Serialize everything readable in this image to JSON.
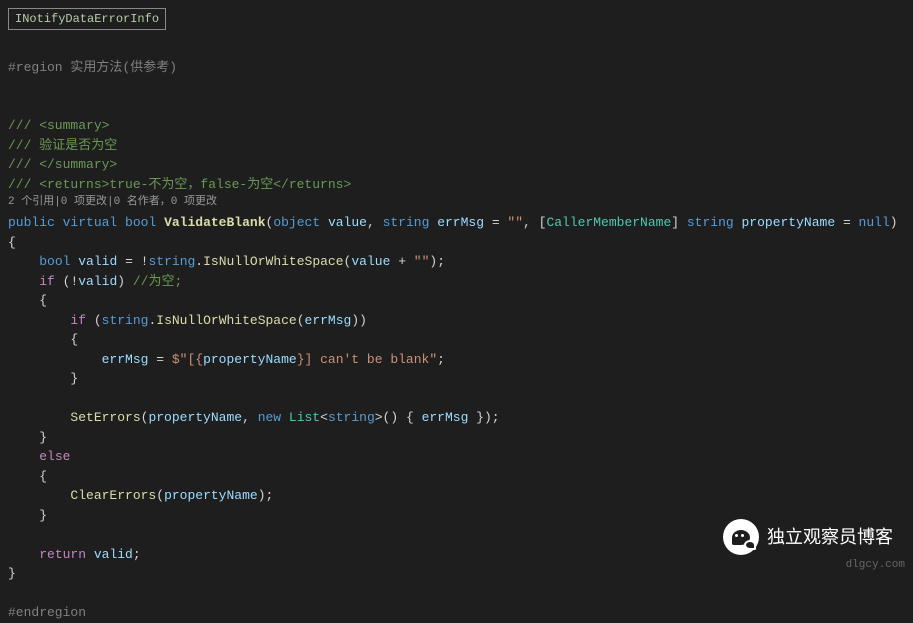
{
  "interface_name": "INotifyDataErrorInfo",
  "region_line": "#region 实用方法(供参考)",
  "doc_comments": {
    "summary_open": "/// <summary>",
    "summary_body": "/// 验证是否为空",
    "summary_close": "/// </summary>",
    "returns": "/// <returns>true-不为空，false-为空</returns>"
  },
  "codelens": "2 个引用|0 项更改|0 名作者，0 项更改",
  "method_signature": {
    "public": "public",
    "virtual": "virtual",
    "bool": "bool",
    "name": "ValidateBlank",
    "param1_type": "object",
    "param1_name": "value",
    "param2_type": "string",
    "param2_name": "errMsg",
    "param2_default": "\"\"",
    "attr": "CallerMemberName",
    "param3_type": "string",
    "param3_name": "propertyName",
    "param3_default": "null"
  },
  "body": {
    "brace_open": "{",
    "line_valid": {
      "bool": "bool",
      "var": "valid",
      "string": "string",
      "method": "IsNullOrWhiteSpace",
      "param": "value",
      "str": "\"\""
    },
    "line_if": {
      "if": "if",
      "var": "valid",
      "comment": "//为空;"
    },
    "inner_if": {
      "if": "if",
      "string": "string",
      "method": "IsNullOrWhiteSpace",
      "param": "errMsg"
    },
    "assign": {
      "var": "errMsg",
      "interp_open": "$\"[{",
      "propname": "propertyName",
      "interp_close": "}] can't be blank\""
    },
    "seterrors": {
      "method": "SetErrors",
      "param1": "propertyName",
      "new": "new",
      "list": "List",
      "string": "string",
      "param2": "errMsg"
    },
    "else": "else",
    "clearerrors": {
      "method": "ClearErrors",
      "param": "propertyName"
    },
    "return": {
      "return": "return",
      "var": "valid"
    },
    "brace_close": "}"
  },
  "endregion": "#endregion",
  "watermark": {
    "text": "独立观察员博客",
    "url": "dlgcy.com"
  }
}
